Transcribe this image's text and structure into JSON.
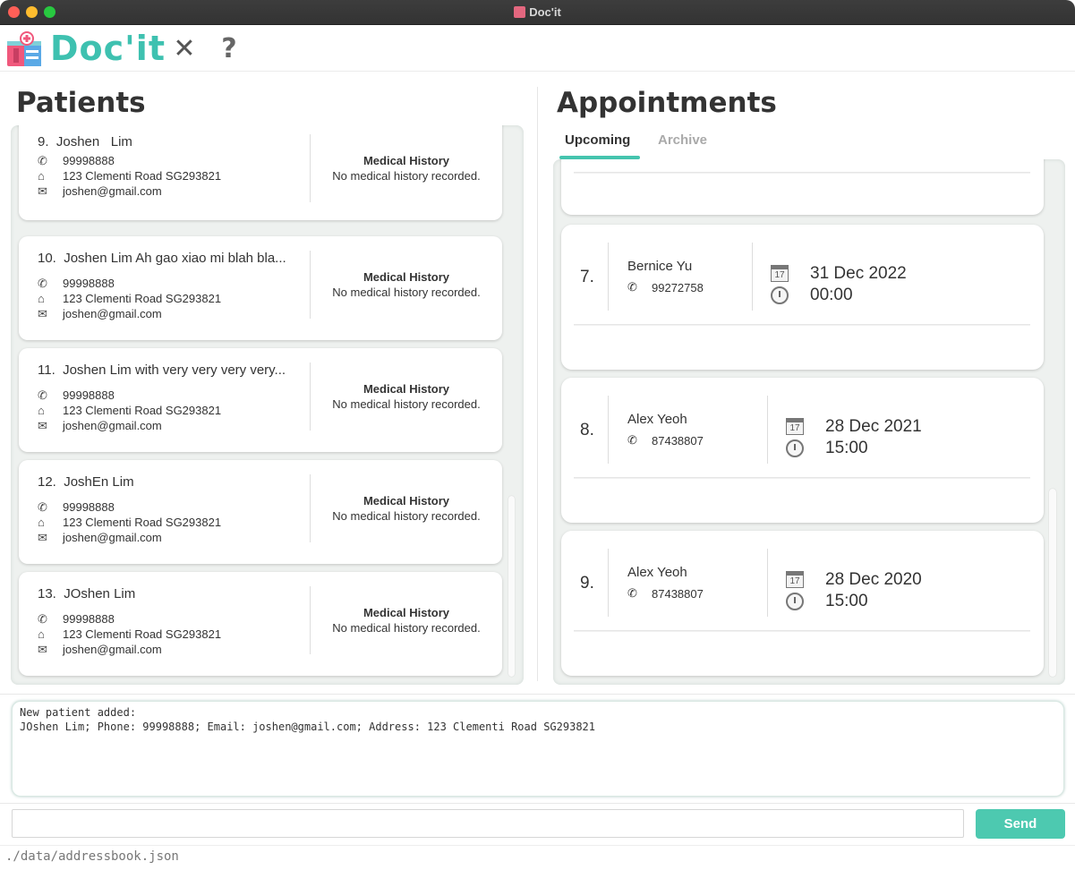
{
  "window": {
    "title": "Doc'it"
  },
  "toolbar": {
    "app_name": "Doc'it",
    "close_label": "✕",
    "help_label": "?"
  },
  "patients": {
    "title": "Patients",
    "mh_title": "Medical History",
    "items": [
      {
        "index": "9.",
        "name": "Joshen   Lim",
        "phone": "99998888",
        "address": "123 Clementi Road SG293821",
        "email": "joshen@gmail.com",
        "medical_history": "No medical history recorded."
      },
      {
        "index": "10.",
        "name": "Joshen Lim Ah gao xiao mi blah bla...",
        "phone": "99998888",
        "address": "123 Clementi Road SG293821",
        "email": "joshen@gmail.com",
        "medical_history": "No medical history recorded."
      },
      {
        "index": "11.",
        "name": "Joshen Lim with very very very very...",
        "phone": "99998888",
        "address": "123 Clementi Road SG293821",
        "email": "joshen@gmail.com",
        "medical_history": "No medical history recorded."
      },
      {
        "index": "12.",
        "name": "JoshEn Lim",
        "phone": "99998888",
        "address": "123 Clementi Road SG293821",
        "email": "joshen@gmail.com",
        "medical_history": "No medical history recorded."
      },
      {
        "index": "13.",
        "name": "JOshen Lim",
        "phone": "99998888",
        "address": "123 Clementi Road SG293821",
        "email": "joshen@gmail.com",
        "medical_history": "No medical history recorded."
      }
    ]
  },
  "appointments": {
    "title": "Appointments",
    "tabs": [
      {
        "label": "Upcoming",
        "active": true
      },
      {
        "label": "Archive",
        "active": false
      }
    ],
    "items": [
      {
        "index": "7.",
        "name": "Bernice Yu",
        "phone": "99272758",
        "date": "31 Dec 2022",
        "time": "00:00"
      },
      {
        "index": "8.",
        "name": "Alex Yeoh",
        "phone": "87438807",
        "date": "28 Dec 2021",
        "time": "15:00"
      },
      {
        "index": "9.",
        "name": "Alex Yeoh",
        "phone": "87438807",
        "date": "28 Dec 2020",
        "time": "15:00"
      }
    ],
    "calendar_day": "17"
  },
  "result": {
    "line1": "New patient added:",
    "line2": "JOshen Lim; Phone: 99998888; Email: joshen@gmail.com; Address: 123 Clementi Road SG293821"
  },
  "command": {
    "value": "",
    "placeholder": "",
    "send_label": "Send"
  },
  "status": {
    "file_path": "./data/addressbook.json"
  },
  "colors": {
    "accent": "#4dc9b0",
    "logo": "#3ec1b0",
    "tab_underline": "#45c4ae"
  },
  "icons": {
    "phone": "phone-icon",
    "address": "house-icon",
    "email": "envelope-icon",
    "calendar": "calendar-icon",
    "clock": "alarm-clock-icon"
  }
}
